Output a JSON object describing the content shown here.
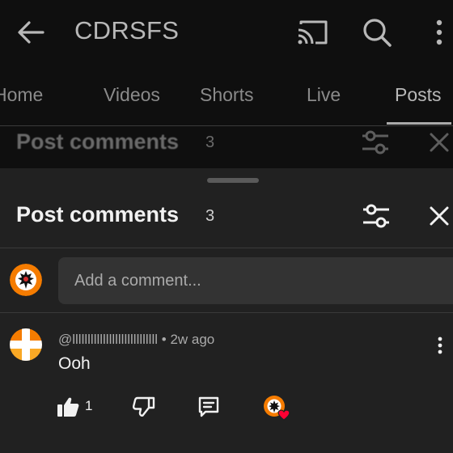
{
  "app_bar": {
    "title": "CDRSFS",
    "icons": [
      "back-arrow-icon",
      "cast-icon",
      "search-icon",
      "more-vert-icon"
    ]
  },
  "tabs": [
    {
      "label": "Home",
      "active": false
    },
    {
      "label": "Videos",
      "active": false
    },
    {
      "label": "Shorts",
      "active": false
    },
    {
      "label": "Live",
      "active": false
    },
    {
      "label": "Posts",
      "active": true
    }
  ],
  "background_header": {
    "title": "Post comments",
    "count": "3"
  },
  "sheet": {
    "title": "Post comments",
    "count": "3",
    "filter_icon": "tune-icon",
    "close_icon": "close-icon",
    "comment_box": {
      "placeholder": "Add a comment...",
      "value": ""
    }
  },
  "comments": [
    {
      "author": "@llllllllllllllllllllllllllll",
      "time": "2w ago",
      "text": "Ooh",
      "likes": "1",
      "creator_hearted": true
    }
  ],
  "colors": {
    "background": "#0f0f0f",
    "sheet": "#212121",
    "input": "#333333",
    "avatar_orange": "#f57c00",
    "heart_red": "#ff0033"
  }
}
